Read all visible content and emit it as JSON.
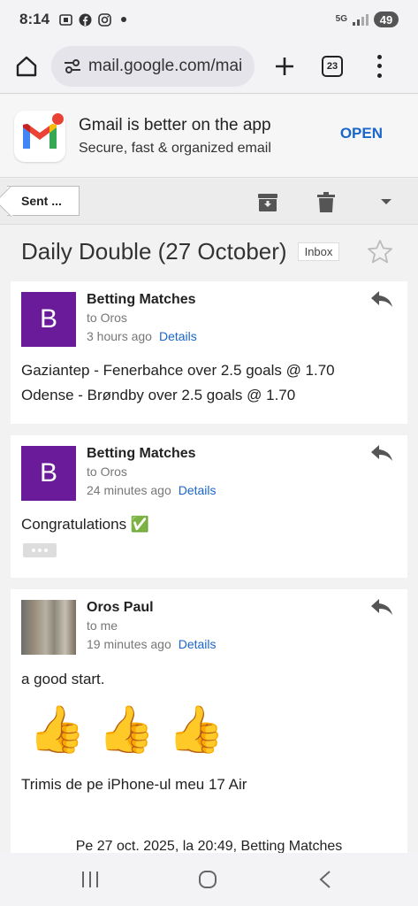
{
  "status": {
    "time": "8:14",
    "network": "5G",
    "battery": "49"
  },
  "browser": {
    "url": "mail.google.com/mai",
    "tab_count": "23"
  },
  "promo": {
    "title": "Gmail is better on the app",
    "subtitle": "Secure, fast & organized email",
    "open_label": "OPEN"
  },
  "toolbar": {
    "back_label": "Sent ..."
  },
  "thread": {
    "subject": "Daily Double (27 October)",
    "label": "Inbox"
  },
  "messages": [
    {
      "avatar_letter": "B",
      "sender": "Betting Matches",
      "to": "to Oros",
      "time": "3 hours ago",
      "details": "Details",
      "body": [
        "Gaziantep - Fenerbahce over 2.5 goals @ 1.70",
        "Odense - Brøndby over 2.5 goals @ 1.70"
      ]
    },
    {
      "avatar_letter": "B",
      "sender": "Betting Matches",
      "to": "to Oros",
      "time": "24 minutes ago",
      "details": "Details",
      "body": [
        "Congratulations ✅"
      ]
    },
    {
      "sender": "Oros Paul",
      "to": "to me",
      "time": "19 minutes ago",
      "details": "Details",
      "body": [
        "a good start."
      ],
      "emoji": "👍👍👍",
      "signature": "Trimis de pe iPhone-ul meu 17 Air",
      "quote": "Pe 27 oct. 2025, la 20:49, Betting Matches"
    }
  ],
  "colors": {
    "accent": "#1a66c9",
    "avatar": "#6a1b9a"
  }
}
